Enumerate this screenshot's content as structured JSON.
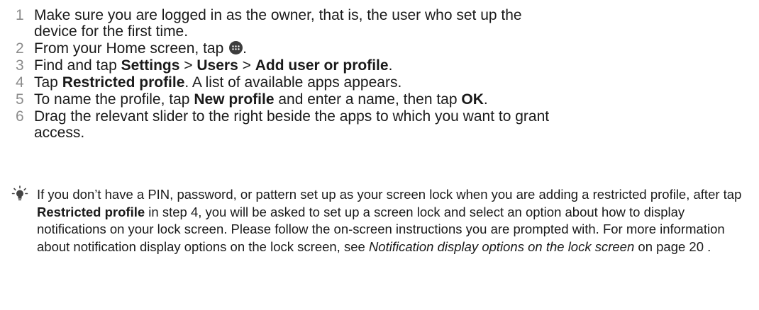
{
  "steps": [
    {
      "num": "1",
      "line1": "Make sure you are logged in as the owner, that is, the user who set up the",
      "line2": "device for the first time."
    },
    {
      "num": "2",
      "pre": "From your Home screen, tap ",
      "icon": "apps-icon",
      "post": "."
    },
    {
      "num": "3",
      "pre": "Find and tap ",
      "b1": "Settings",
      "sep1": " > ",
      "b2": "Users",
      "sep2": " > ",
      "b3": "Add user or profile",
      "post": "."
    },
    {
      "num": "4",
      "pre": "Tap ",
      "b1": "Restricted profile",
      "post": ". A list of available apps appears."
    },
    {
      "num": "5",
      "pre": "To name the profile, tap ",
      "b1": "New profile",
      "mid": " and enter a name, then tap ",
      "b2": "OK",
      "post": "."
    },
    {
      "num": "6",
      "line1": "Drag the relevant slider to the right beside the apps to which you want to grant",
      "line2": "access."
    }
  ],
  "tip": {
    "icon": "lightbulb-icon",
    "t1": "If you don’t have a PIN, password, or pattern set up as your screen lock when you are adding a restricted profile, after tap ",
    "b1": "Restricted profile",
    "t2": " in step 4, you will be asked to set up a screen lock and select an option about how to display notifications on your lock screen. Please follow the on-screen instructions you are prompted with. For more information about notification display options on the lock screen, see ",
    "link": "Notification display options on the lock screen",
    "t3": " on page 20 ."
  }
}
